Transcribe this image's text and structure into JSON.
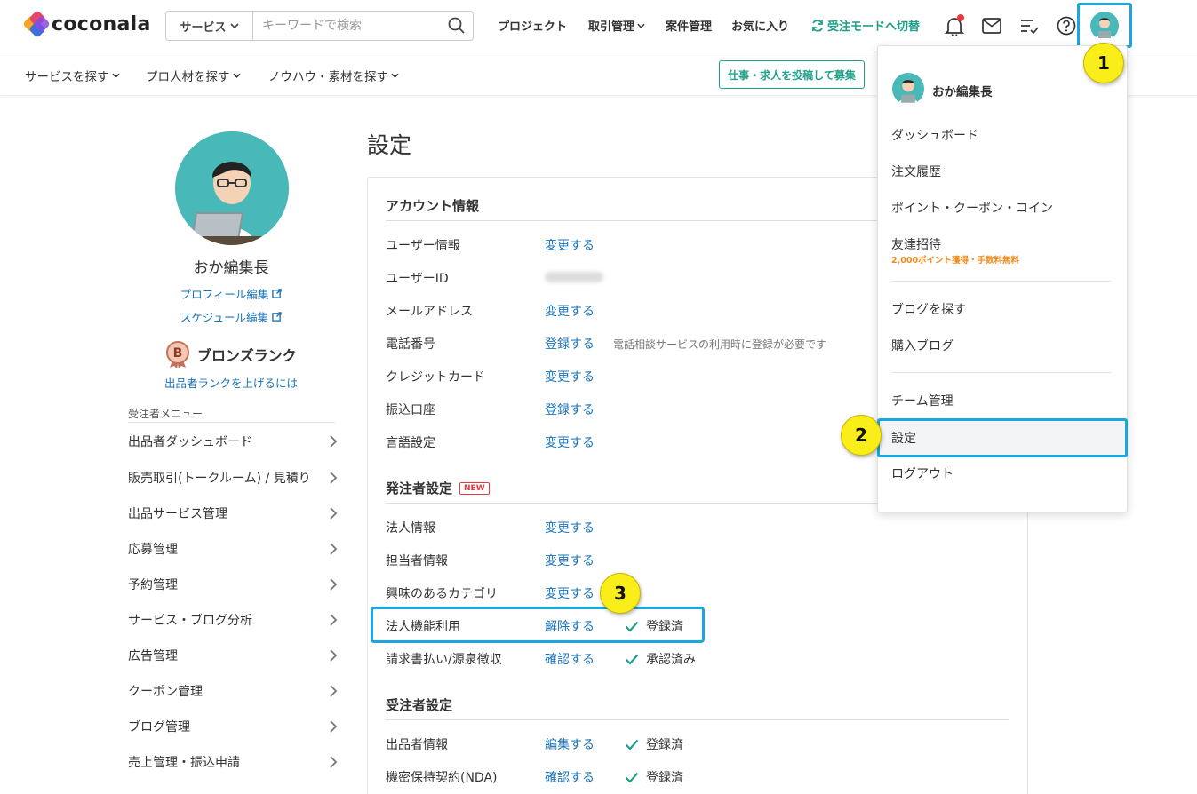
{
  "header": {
    "logo_text": "coconala",
    "search": {
      "category": "サービス",
      "placeholder": "キーワードで検索"
    },
    "nav": {
      "project": "プロジェクト",
      "transactions": "取引管理",
      "jobs": "案件管理",
      "favorites": "お気に入り",
      "mode_switch": "受注モードへ切替"
    }
  },
  "subnav": {
    "find_service": "サービスを探す",
    "find_pro": "プロ人材を探す",
    "knowhow": "ノウハウ・素材を探す",
    "post_job": "仕事・求人を投稿して募集"
  },
  "profile": {
    "name": "おか編集長",
    "edit_profile": "プロフィール編集",
    "edit_schedule": "スケジュール編集",
    "rank_letter": "B",
    "rank": "ブロンズランク",
    "rank_link": "出品者ランクを上げるには"
  },
  "side_menu": {
    "heading": "受注者メニュー",
    "items": [
      {
        "label": "出品者ダッシュボード"
      },
      {
        "label": "販売取引(トークルーム) / 見積り"
      },
      {
        "label": "出品サービス管理"
      },
      {
        "label": "応募管理"
      },
      {
        "label": "予約管理"
      },
      {
        "label": "サービス・ブログ分析"
      },
      {
        "label": "広告管理"
      },
      {
        "label": "クーポン管理"
      },
      {
        "label": "ブログ管理"
      },
      {
        "label": "売上管理・振込申請"
      }
    ]
  },
  "main": {
    "title": "設定",
    "account": {
      "title": "アカウント情報",
      "rows": [
        {
          "label": "ユーザー情報",
          "action": "変更する"
        },
        {
          "label": "ユーザーID",
          "action": ""
        },
        {
          "label": "メールアドレス",
          "action": "変更する"
        },
        {
          "label": "電話番号",
          "action": "登録する",
          "note": "電話相談サービスの利用時に登録が必要です"
        },
        {
          "label": "クレジットカード",
          "action": "変更する"
        },
        {
          "label": "振込口座",
          "action": "登録する"
        },
        {
          "label": "言語設定",
          "action": "変更する"
        }
      ]
    },
    "buyer": {
      "title": "発注者設定",
      "badge": "NEW",
      "rows": [
        {
          "label": "法人情報",
          "action": "変更する"
        },
        {
          "label": "担当者情報",
          "action": "変更する"
        },
        {
          "label": "興味のあるカテゴリ",
          "action": "変更する"
        },
        {
          "label": "法人機能利用",
          "action": "解除する",
          "status": "登録済"
        },
        {
          "label": "請求書払い/源泉徴収",
          "action": "確認する",
          "status": "承認済み"
        }
      ]
    },
    "seller": {
      "title": "受注者設定",
      "rows": [
        {
          "label": "出品者情報",
          "action": "編集する",
          "status": "登録済"
        },
        {
          "label": "機密保持契約(NDA)",
          "action": "確認する",
          "status": "登録済"
        }
      ]
    }
  },
  "dropdown": {
    "name": "おか編集長",
    "items": {
      "dashboard": "ダッシュボード",
      "orders": "注文履歴",
      "points": "ポイント・クーポン・コイン",
      "invite": "友達招待",
      "invite_sub": "2,000ポイント獲得・手数料無料",
      "find_blog": "ブログを探す",
      "purchased_blog": "購入ブログ",
      "team": "チーム管理",
      "settings": "設定",
      "logout": "ログアウト"
    }
  },
  "steps": [
    "1",
    "2",
    "3"
  ],
  "colors": {
    "accent_green": "#20a08a",
    "link_blue": "#1a73b8",
    "highlight_blue": "#1aa7e0",
    "step_yellow": "#f9ee1a",
    "notif_red": "#e8383d"
  },
  "icons": [
    "search-icon",
    "bell-icon",
    "mail-icon",
    "checklist-icon",
    "help-icon",
    "sync-icon",
    "external-edit-icon",
    "check-icon",
    "chevron-right-icon",
    "chevron-down-icon"
  ]
}
